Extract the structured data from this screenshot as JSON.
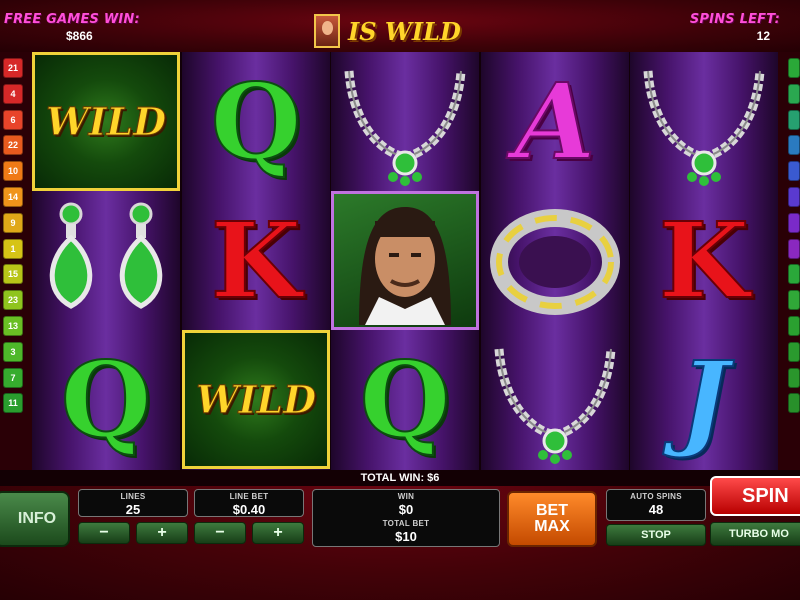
{
  "header": {
    "free_games_label": "FREE GAMES WIN:",
    "free_games_value": "$866",
    "wild_banner": "IS WILD",
    "spins_left_label": "SPINS LEFT:",
    "spins_left_value": "12"
  },
  "paylines_left": [
    {
      "label": "21",
      "color": "#d62828"
    },
    {
      "label": "4",
      "color": "#d62828"
    },
    {
      "label": "6",
      "color": "#e8442a"
    },
    {
      "label": "22",
      "color": "#e85a1e"
    },
    {
      "label": "10",
      "color": "#f07a16"
    },
    {
      "label": "14",
      "color": "#f0941a"
    },
    {
      "label": "9",
      "color": "#e0a818"
    },
    {
      "label": "1",
      "color": "#d6c416"
    },
    {
      "label": "15",
      "color": "#b8c418"
    },
    {
      "label": "23",
      "color": "#8fc41e"
    },
    {
      "label": "13",
      "color": "#6abf24"
    },
    {
      "label": "3",
      "color": "#4eb82a"
    },
    {
      "label": "7",
      "color": "#36ac2e"
    },
    {
      "label": "11",
      "color": "#2a9e2e"
    }
  ],
  "paylines_right": [
    {
      "label": "",
      "color": "#2aa838"
    },
    {
      "label": "",
      "color": "#2aa850"
    },
    {
      "label": "",
      "color": "#26a070"
    },
    {
      "label": "",
      "color": "#2a7ac0"
    },
    {
      "label": "",
      "color": "#3a5ad0"
    },
    {
      "label": "",
      "color": "#5a3ad0"
    },
    {
      "label": "",
      "color": "#7a2ac8"
    },
    {
      "label": "",
      "color": "#8a28c0"
    },
    {
      "label": "",
      "color": "#2aa83a"
    },
    {
      "label": "",
      "color": "#30a838"
    },
    {
      "label": "",
      "color": "#2aa030"
    },
    {
      "label": "",
      "color": "#2a9a2e"
    },
    {
      "label": "",
      "color": "#2a962c"
    },
    {
      "label": "",
      "color": "#28902a"
    }
  ],
  "symbols": {
    "wild_text": "WILD",
    "q": "Q",
    "k": "K",
    "a": "A",
    "j": "J"
  },
  "total_win": "TOTAL WIN: $6",
  "controls": {
    "info": "INFO",
    "lines_label": "LINES",
    "lines_value": "25",
    "line_bet_label": "LINE BET",
    "line_bet_value": "$0.40",
    "minus": "−",
    "plus": "+",
    "win_label": "WIN",
    "win_value": "$0",
    "total_bet_label": "TOTAL BET",
    "total_bet_value": "$10",
    "bet_max_line1": "BET",
    "bet_max_line2": "MAX",
    "auto_spins_label": "AUTO SPINS",
    "auto_spins_value": "48",
    "stop": "STOP",
    "spin": "SPIN",
    "turbo": "TURBO MO"
  }
}
